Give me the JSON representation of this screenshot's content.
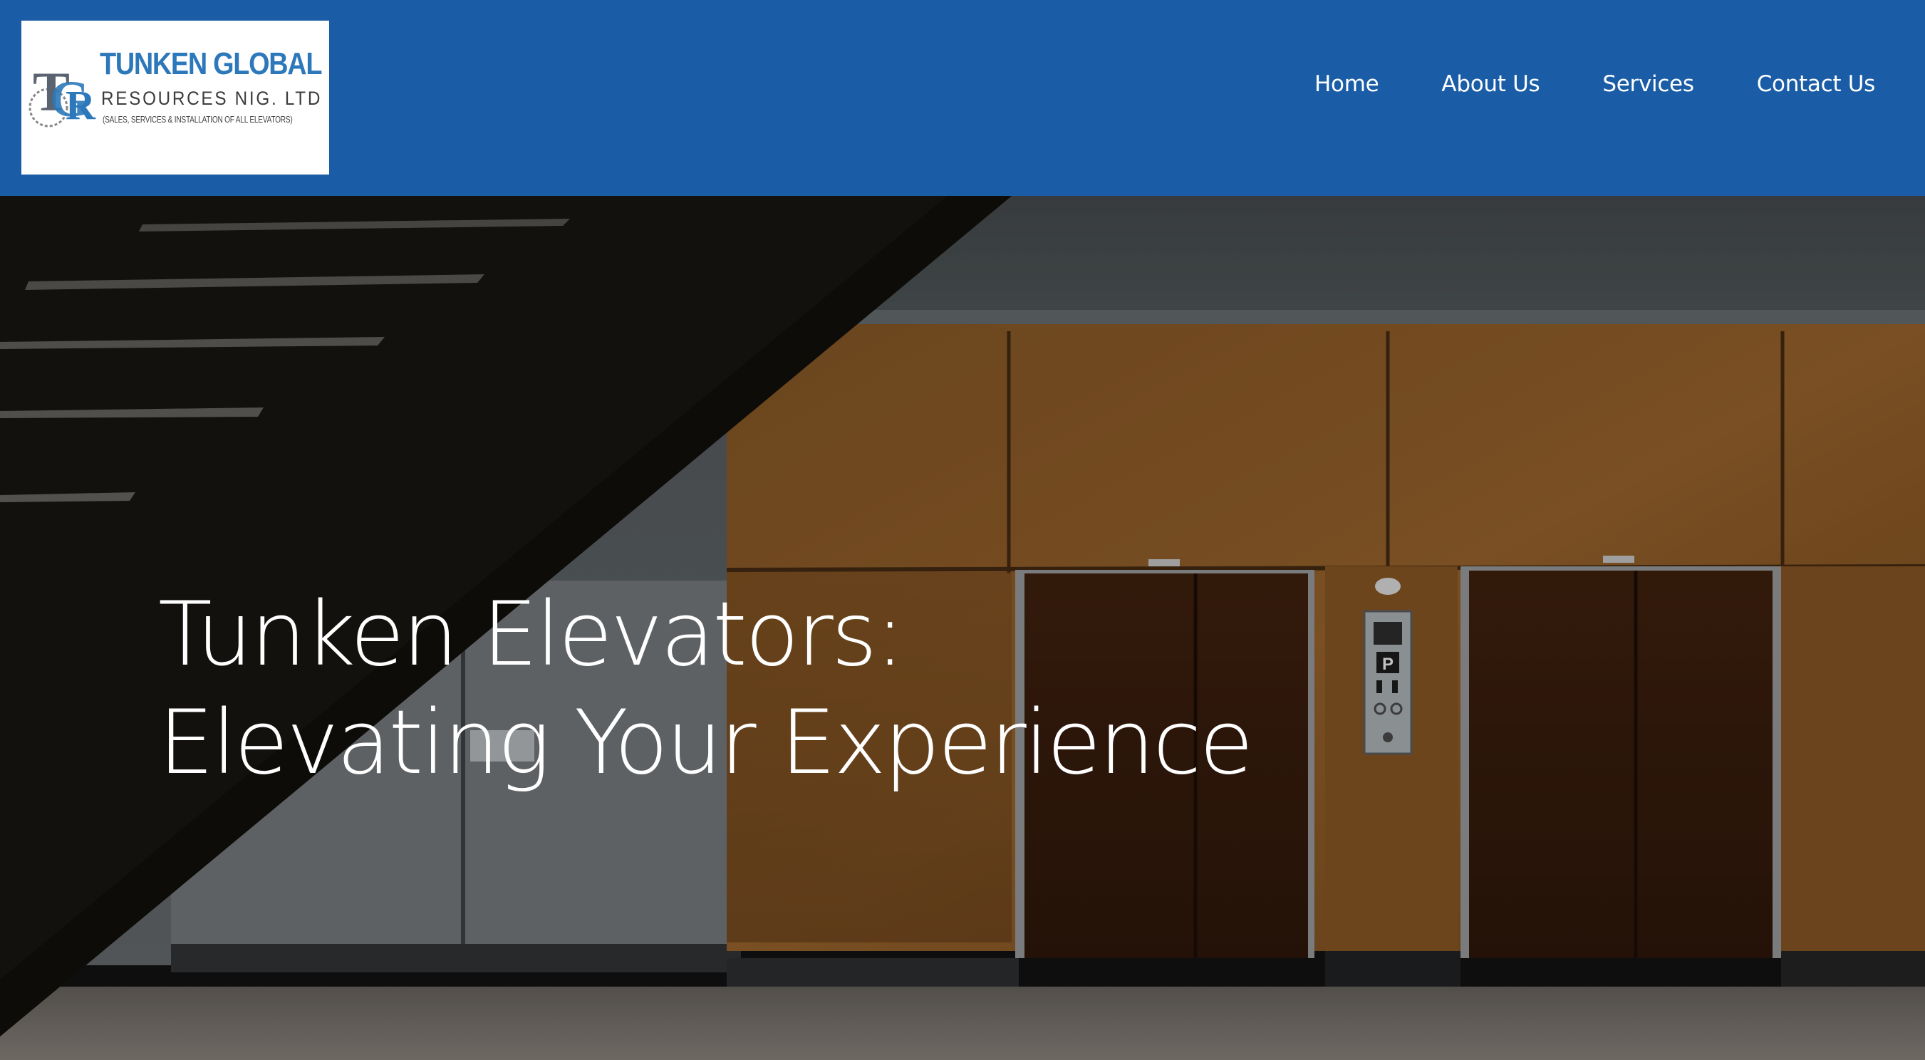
{
  "brand": {
    "line1": "TUNKEN GLOBAL",
    "line2": "RESOURCES NIG. LTD",
    "line3": "(SALES, SERVICES & INSTALLATION OF ALL ELEVATORS)",
    "colors": {
      "primary": "#1a5da6",
      "logo_blue": "#2c78ba"
    }
  },
  "nav": {
    "items": [
      {
        "label": "Home"
      },
      {
        "label": "About Us"
      },
      {
        "label": "Services"
      },
      {
        "label": "Contact Us"
      }
    ]
  },
  "hero": {
    "title_line1": "Tunken Elevators:",
    "title_line2": "Elevating Your Experience",
    "image": "elevator-lobby-photo"
  }
}
